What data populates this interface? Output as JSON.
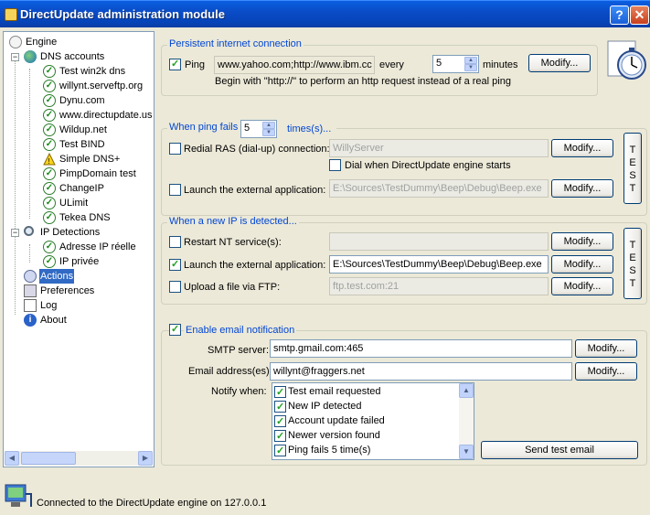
{
  "window": {
    "title": "DirectUpdate administration module",
    "help_label": "?",
    "close_label": "✕"
  },
  "tree": {
    "items": [
      {
        "label": "Engine"
      },
      {
        "label": "DNS accounts"
      },
      {
        "label": "Test win2k dns"
      },
      {
        "label": "willynt.serveftp.org"
      },
      {
        "label": "Dynu.com"
      },
      {
        "label": "www.directupdate.us"
      },
      {
        "label": "Wildup.net"
      },
      {
        "label": "Test BIND"
      },
      {
        "label": "Simple DNS+"
      },
      {
        "label": "PimpDomain test"
      },
      {
        "label": "ChangeIP"
      },
      {
        "label": "ULimit"
      },
      {
        "label": "Tekea DNS"
      },
      {
        "label": "IP Detections"
      },
      {
        "label": "Adresse IP réelle"
      },
      {
        "label": "IP privée"
      },
      {
        "label": "Actions"
      },
      {
        "label": "Preferences"
      },
      {
        "label": "Log"
      },
      {
        "label": "About"
      }
    ],
    "selected": "Actions"
  },
  "persistent": {
    "title": "Persistent internet connection",
    "ping_label": "Ping",
    "ping_checked": true,
    "ping_hosts": "www.yahoo.com;http://www.ibm.cc",
    "every_label": "every",
    "minutes_value": "5",
    "minutes_label": "minutes",
    "modify_label": "Modify...",
    "hint": "Begin with \"http://\" to perform an http request instead of a real ping"
  },
  "ping_fails": {
    "title_prefix": "When ping fails",
    "count": "5",
    "title_suffix": "times(s)...",
    "redial_label": "Redial RAS (dial-up) connection:",
    "redial_value": "WillyServer",
    "redial_checked": false,
    "modify_label": "Modify...",
    "dial_label": "Dial when DirectUpdate engine starts",
    "launch_label": "Launch the external application:",
    "launch_value": "E:\\Sources\\TestDummy\\Beep\\Debug\\Beep.exe",
    "launch_checked": false,
    "test_letters": [
      "T",
      "E",
      "S",
      "T"
    ]
  },
  "new_ip": {
    "title": "When a new IP is detected...",
    "restart_label": "Restart NT service(s):",
    "restart_value": "",
    "launch_label": "Launch the external application:",
    "launch_value": "E:\\Sources\\TestDummy\\Beep\\Debug\\Beep.exe",
    "launch_checked": true,
    "ftp_label": "Upload a file via FTP:",
    "ftp_value": "ftp.test.com:21",
    "modify_label": "Modify...",
    "test_letters": [
      "T",
      "E",
      "S",
      "T"
    ]
  },
  "email": {
    "enable_label": "Enable email notification",
    "enabled": true,
    "smtp_label": "SMTP server:",
    "smtp_value": "smtp.gmail.com:465",
    "address_label": "Email address(es):",
    "address_value": "willynt@fraggers.net",
    "modify_label": "Modify...",
    "notify_label": "Notify when:",
    "notify_items": [
      {
        "label": "Test email requested",
        "checked": true
      },
      {
        "label": "New IP detected",
        "checked": true
      },
      {
        "label": "Account update failed",
        "checked": true
      },
      {
        "label": "Newer version found",
        "checked": true
      },
      {
        "label": "Ping fails 5 time(s)",
        "checked": true
      }
    ],
    "send_test_label": "Send test email"
  },
  "status": {
    "text": "Connected to the DirectUpdate engine on 127.0.0.1"
  }
}
